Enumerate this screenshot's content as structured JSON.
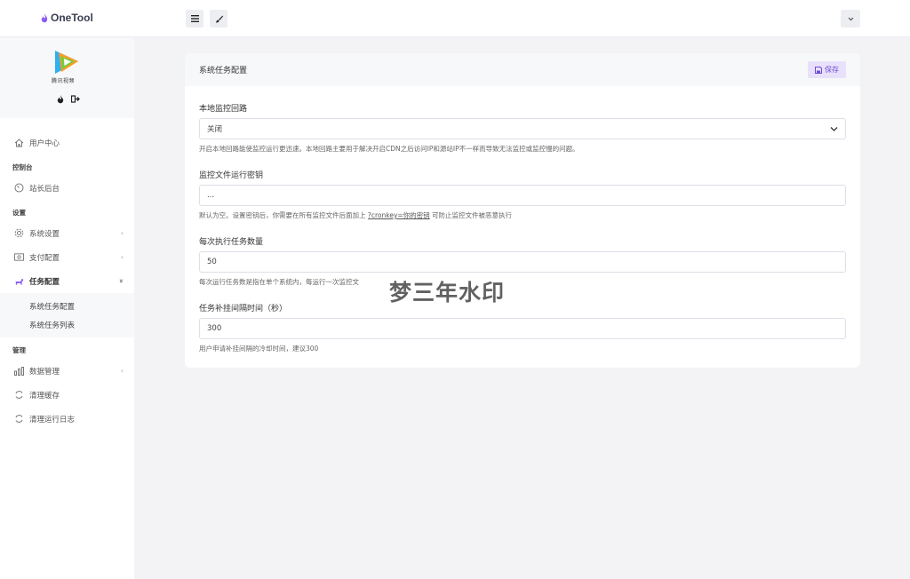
{
  "brand": {
    "name": "OneTool"
  },
  "topbar": {
    "menu_icon": "menu-icon",
    "brush_icon": "brush-icon",
    "user_icon": "chevron-down-icon"
  },
  "sidebar": {
    "logo_caption": "腾讯视频",
    "items": [
      {
        "label": "用户中心",
        "icon": "home-icon"
      },
      {
        "section": "控制台"
      },
      {
        "label": "站长后台",
        "icon": "gauge-icon"
      },
      {
        "section": "设置"
      },
      {
        "label": "系统设置",
        "icon": "gear-icon",
        "arrow": "‹"
      },
      {
        "label": "支付配置",
        "icon": "money-icon",
        "arrow": "‹"
      },
      {
        "label": "任务配置",
        "icon": "dog-icon",
        "arrow": "»"
      },
      {
        "section": "管理"
      },
      {
        "label": "数据管理",
        "icon": "chart-icon",
        "arrow": "‹"
      },
      {
        "label": "清理缓存",
        "icon": "refresh-icon"
      },
      {
        "label": "清理运行日志",
        "icon": "refresh-icon"
      }
    ],
    "sub_items": [
      "系统任务配置",
      "系统任务列表"
    ]
  },
  "card": {
    "title": "系统任务配置",
    "save_label": "保存",
    "fields": [
      {
        "label": "本地监控回路",
        "value": "关闭",
        "help": "开启本地回路能使监控运行更迅速。本地回路主要用于解决开启CDN之后访问IP和源站IP不一样而导致无法监控或监控慢的问题。"
      },
      {
        "label": "监控文件运行密钥",
        "value": "...",
        "help_prefix": "默认为空。设置密钥后，你需要在所有监控文件后面加上 ",
        "help_link": "?cronkey=你的密钥",
        "help_suffix": " 可防止监控文件被恶意执行"
      },
      {
        "label": "每次执行任务数量",
        "value": "50",
        "help": "每次运行任务数是指在单个系统内，每运行一次监控文"
      },
      {
        "label": "任务补挂间隔时间（秒）",
        "value": "300",
        "help": "用户申请补挂间隔的冷却时间，建议300"
      }
    ]
  },
  "watermark": "梦三年水印",
  "colors": {
    "accent": "#8b5cf6",
    "save_bg": "#e9e1fb",
    "save_text": "#6d4bd8"
  }
}
